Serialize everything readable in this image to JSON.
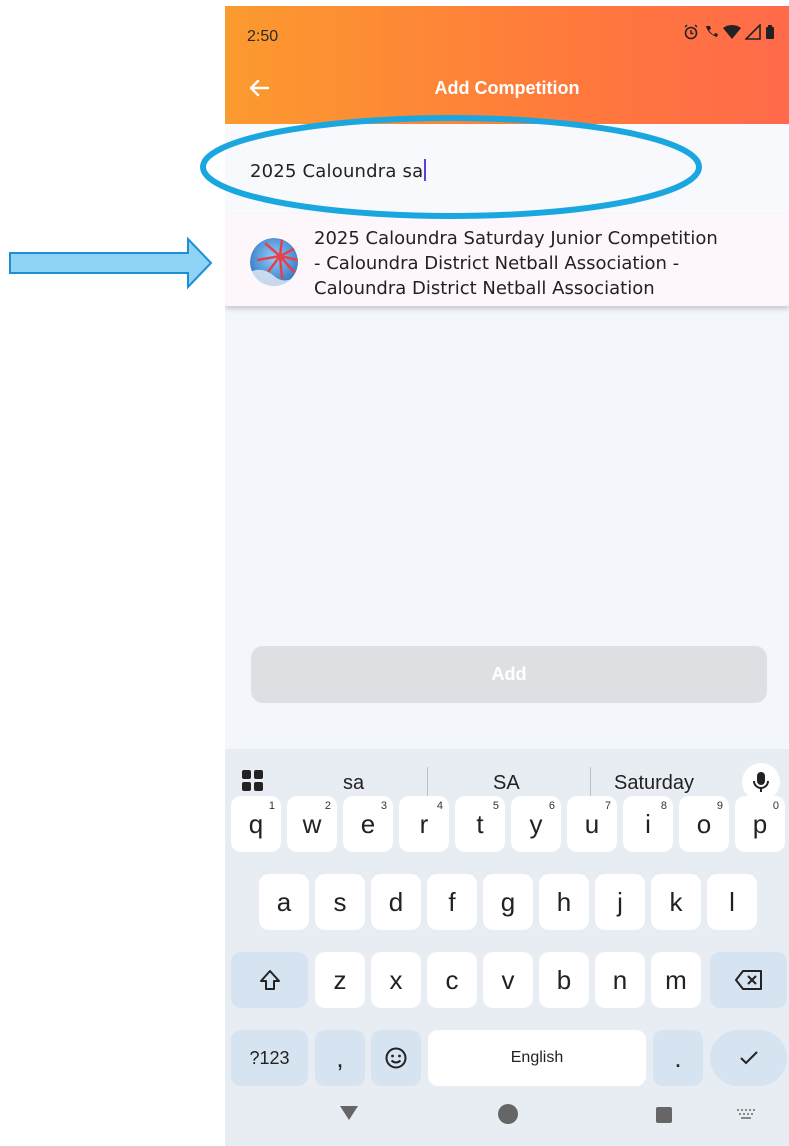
{
  "status_bar": {
    "time": "2:50",
    "icons": [
      "alarm-icon",
      "call-icon",
      "wifi-icon",
      "signal-icon",
      "battery-icon"
    ]
  },
  "appbar": {
    "title": "Add Competition",
    "back_icon": "back-arrow-icon"
  },
  "search": {
    "value": "2025 Caloundra sa"
  },
  "suggestion": {
    "lines": [
      "2025 Caloundra Saturday Junior Competition",
      "- Caloundra District Netball Association -",
      "Caloundra District Netball Association"
    ]
  },
  "add_button": {
    "label": "Add"
  },
  "keyboard": {
    "suggestions": [
      "sa",
      "SA",
      "Saturday"
    ],
    "row1": [
      {
        "k": "q",
        "s": "1"
      },
      {
        "k": "w",
        "s": "2"
      },
      {
        "k": "e",
        "s": "3"
      },
      {
        "k": "r",
        "s": "4"
      },
      {
        "k": "t",
        "s": "5"
      },
      {
        "k": "y",
        "s": "6"
      },
      {
        "k": "u",
        "s": "7"
      },
      {
        "k": "i",
        "s": "8"
      },
      {
        "k": "o",
        "s": "9"
      },
      {
        "k": "p",
        "s": "0"
      }
    ],
    "row2": [
      "a",
      "s",
      "d",
      "f",
      "g",
      "h",
      "j",
      "k",
      "l"
    ],
    "row3": [
      "z",
      "x",
      "c",
      "v",
      "b",
      "n",
      "m"
    ],
    "symbols_label": "?123",
    "comma_label": ",",
    "space_label": "English",
    "period_label": "."
  },
  "colors": {
    "appbar_start": "#fb9a2e",
    "appbar_end": "#ff6a4a",
    "annotation": "#1aa7e0"
  }
}
